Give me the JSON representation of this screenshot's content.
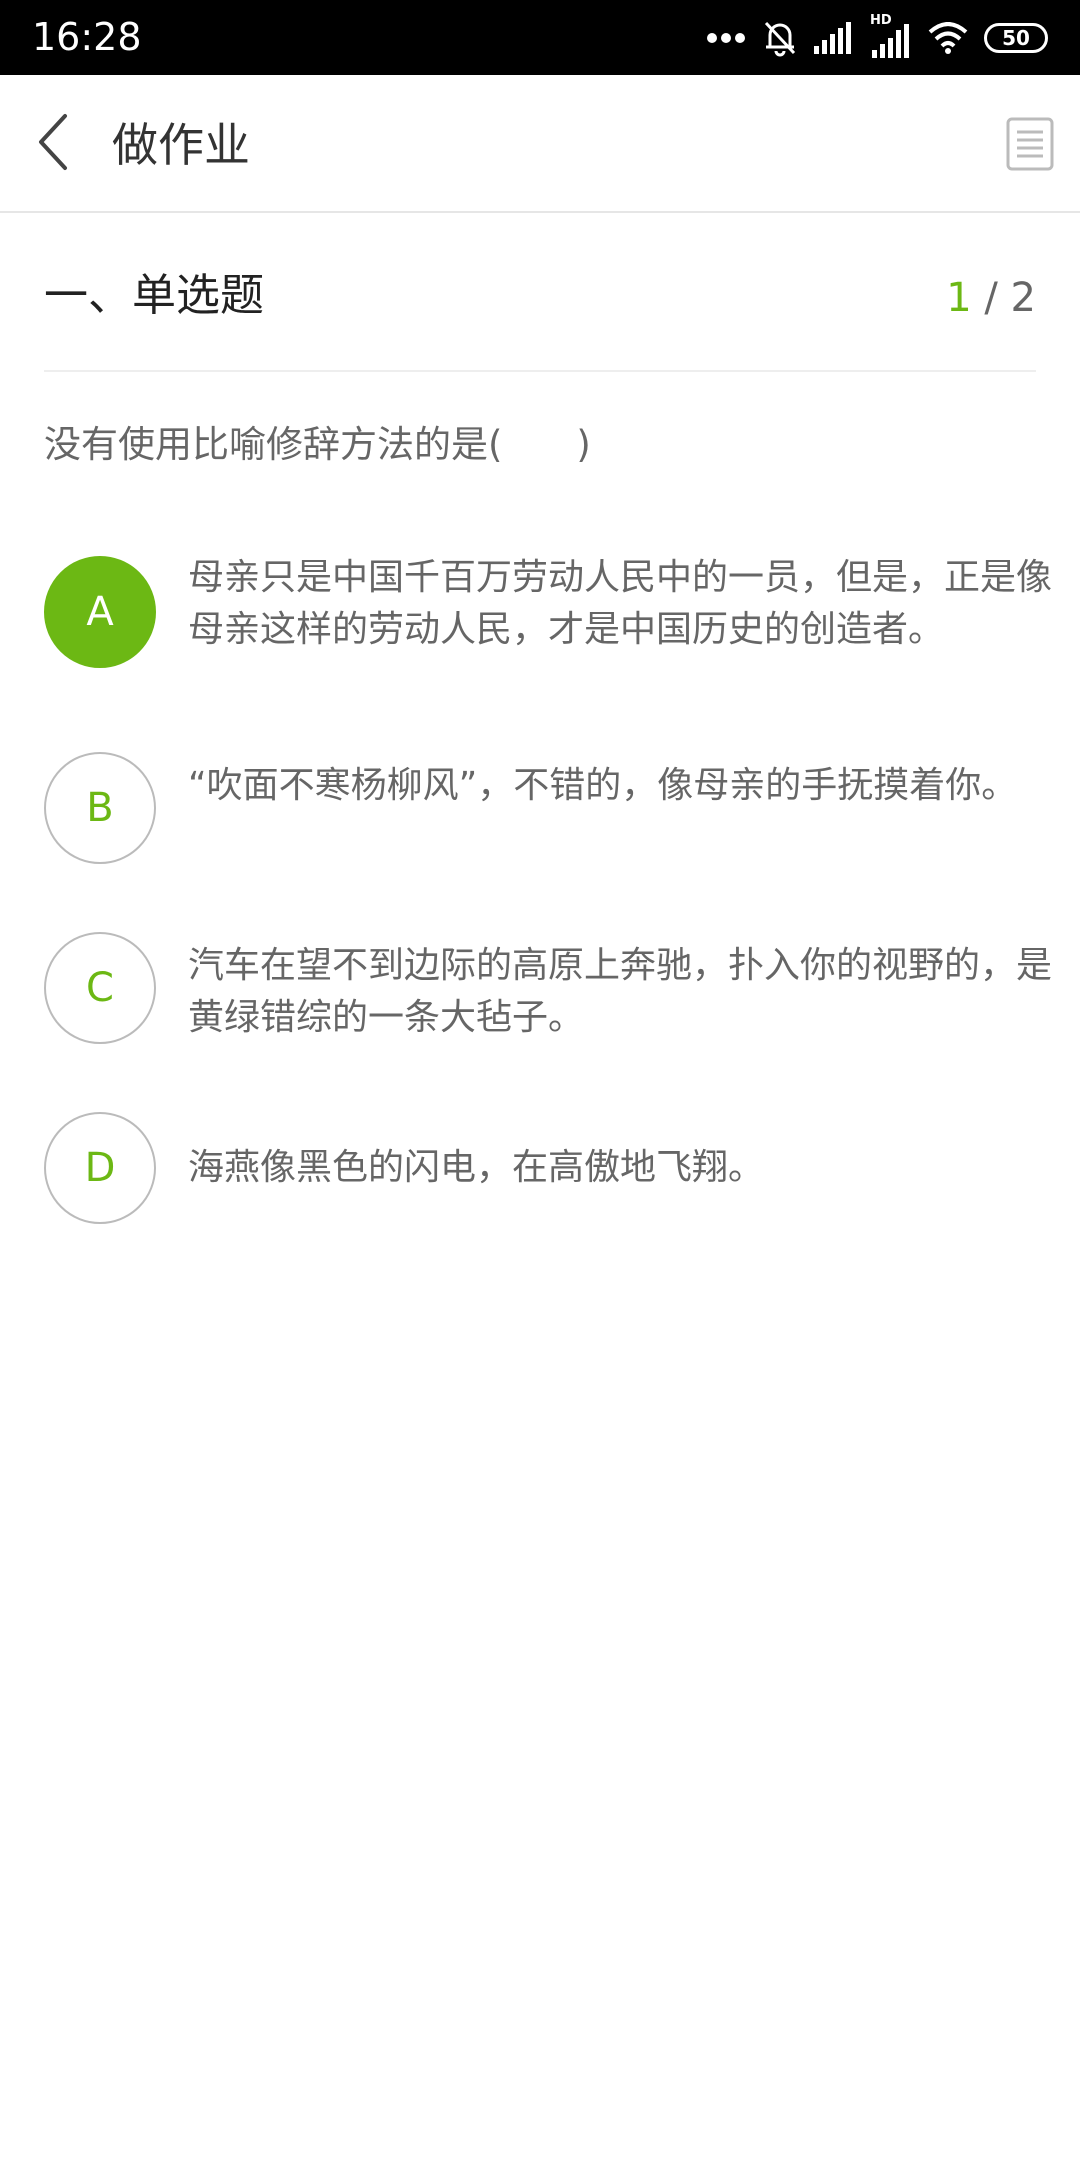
{
  "status_bar": {
    "time": "16:28",
    "battery": "50",
    "network_label": "HD",
    "icons": [
      "more-dots-icon",
      "mute-icon",
      "signal-icon",
      "hd-signal-icon",
      "wifi-icon",
      "battery-icon"
    ]
  },
  "header": {
    "title": "做作业",
    "back_icon": "chevron-left-icon",
    "menu_icon": "list-icon"
  },
  "section": {
    "title": "一、单选题",
    "current": "1",
    "separator": " / ",
    "total": "2"
  },
  "question": {
    "text": "没有使用比喻修辞方法的是(　　)"
  },
  "options": [
    {
      "letter": "A",
      "selected": true,
      "text": "母亲只是中国千百万劳动人民中的一员，但是，正是像母亲这样的劳动人民，才是中国历史的创造者。"
    },
    {
      "letter": "B",
      "selected": false,
      "text": "“吹面不寒杨柳风”，不错的，像母亲的手抚摸着你。"
    },
    {
      "letter": "C",
      "selected": false,
      "text": "汽车在望不到边际的高原上奔驰，扑入你的视野的，是黄绿错综的一条大毡子。"
    },
    {
      "letter": "D",
      "selected": false,
      "text": "海燕像黑色的闪电，在高傲地飞翔。"
    }
  ],
  "colors": {
    "accent": "#6cb814",
    "text_secondary": "#666666",
    "border": "#bbbbbb",
    "status_bar_bg": "#000000"
  }
}
